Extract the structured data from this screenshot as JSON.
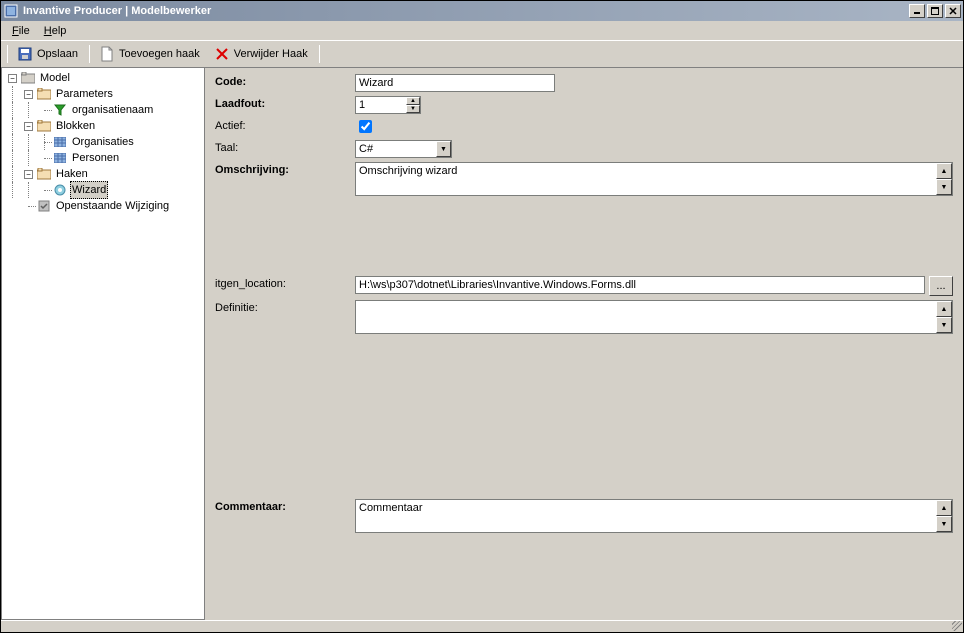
{
  "window": {
    "title": "Invantive Producer | Modelbewerker"
  },
  "menu": {
    "file": "File",
    "help": "Help"
  },
  "toolbar": {
    "save": "Opslaan",
    "add_hook": "Toevoegen haak",
    "remove_hook": "Verwijder Haak"
  },
  "tree": {
    "model": "Model",
    "parameters": "Parameters",
    "organisatienaam": "organisatienaam",
    "blokken": "Blokken",
    "organisaties": "Organisaties",
    "personen": "Personen",
    "haken": "Haken",
    "wizard": "Wizard",
    "openstaande": "Openstaande Wijziging"
  },
  "form": {
    "code_label": "Code:",
    "code_value": "Wizard",
    "laadfout_label": "Laadfout:",
    "laadfout_value": "1",
    "actief_label": "Actief:",
    "actief_checked": true,
    "taal_label": "Taal:",
    "taal_value": "C#",
    "omschrijving_label": "Omschrijving:",
    "omschrijving_value": "Omschrijving wizard",
    "location_label": "itgen_location:",
    "location_value": "H:\\ws\\p307\\dotnet\\Libraries\\Invantive.Windows.Forms.dll",
    "definitie_label": "Definitie:",
    "definitie_value": "",
    "commentaar_label": "Commentaar:",
    "commentaar_value": "Commentaar",
    "browse_label": "..."
  }
}
